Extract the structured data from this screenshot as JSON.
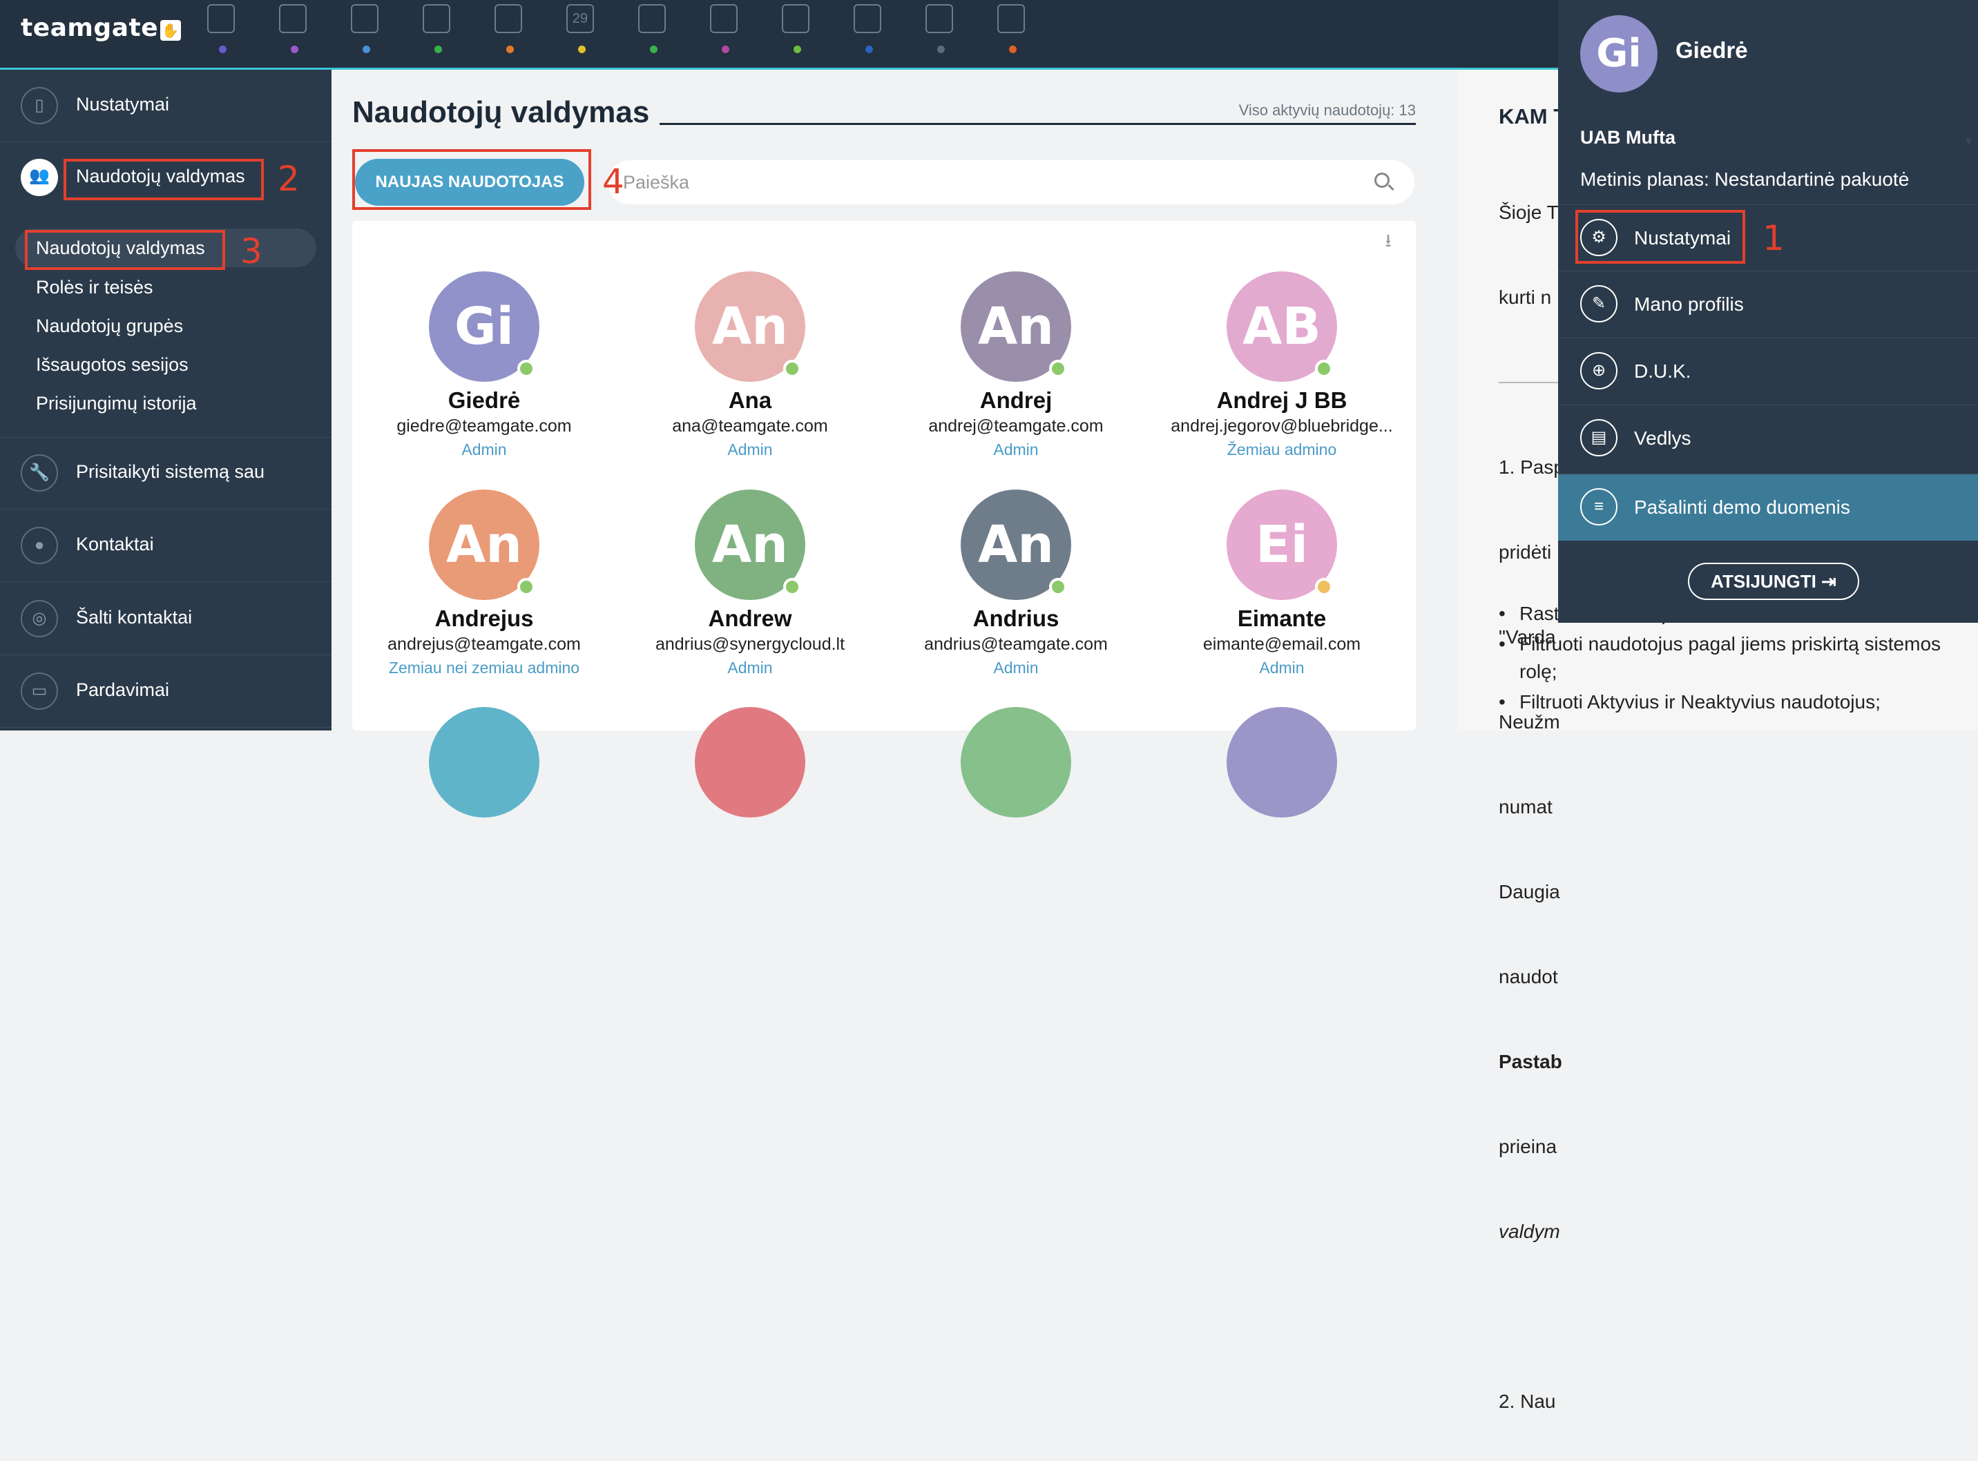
{
  "app": {
    "logo": "teamgate",
    "logo_mark": "✋"
  },
  "topnav": {
    "icons": [
      {
        "name": "dashboard-icon",
        "dot": "#6a5acd"
      },
      {
        "name": "target-icon",
        "dot": "#9b59d0"
      },
      {
        "name": "buildings-icon",
        "dot": "#4a90d9"
      },
      {
        "name": "contact-icon",
        "dot": "#38b24a"
      },
      {
        "name": "briefcase-icon",
        "dot": "#e07b2a"
      },
      {
        "name": "calendar-icon",
        "dot": "#e0c22a",
        "text": "29"
      },
      {
        "name": "chat-icon",
        "dot": "#38b24a"
      },
      {
        "name": "inbox-icon",
        "dot": "#b04aa0"
      },
      {
        "name": "attachment-icon",
        "dot": "#6bbf3a"
      },
      {
        "name": "pie-chart-icon",
        "dot": "#2a64c0"
      },
      {
        "name": "notes-icon",
        "dot": "#5a6a78"
      },
      {
        "name": "document-icon",
        "dot": "#e0602a"
      }
    ]
  },
  "sidebar": {
    "settings": "Nustatymai",
    "users": "Naudotojų valdymas",
    "sub": [
      "Naudotojų valdymas",
      "Rolės ir teisės",
      "Naudotojų grupės",
      "Išsaugotos sesijos",
      "Prisijungimų istorija"
    ],
    "customize": "Prisitaikyti sistemą sau",
    "contacts": "Kontaktai",
    "cold": "Šalti kontaktai",
    "sales": "Pardavimai"
  },
  "main": {
    "title": "Naudotojų valdymas",
    "total_users": "Viso aktyvių naudotojų: 13",
    "new_user_button": "NAUJAS NAUDOTOJAS",
    "search_placeholder": "Paieška",
    "users": [
      {
        "initials": "Gi",
        "name": "Giedrė",
        "email": "giedre@teamgate.com",
        "role": "Admin",
        "color": "#9192c9",
        "status": "#8cc96a"
      },
      {
        "initials": "An",
        "name": "Ana",
        "email": "ana@teamgate.com",
        "role": "Admin",
        "color": "#e8b2b0",
        "status": "#8cc96a"
      },
      {
        "initials": "An",
        "name": "Andrej",
        "email": "andrej@teamgate.com",
        "role": "Admin",
        "color": "#9a8faa",
        "status": "#8cc96a"
      },
      {
        "initials": "AB",
        "name": "Andrej J BB",
        "email": "andrej.jegorov@bluebridge...",
        "role": "Žemiau admino",
        "color": "#e3aad0",
        "status": "#8cc96a"
      },
      {
        "initials": "An",
        "name": "Andrejus",
        "email": "andrejus@teamgate.com",
        "role": "Zemiau nei zemiau admino",
        "color": "#e99a76",
        "status": "#8cc96a"
      },
      {
        "initials": "An",
        "name": "Andrew",
        "email": "andrius@synergycloud.lt",
        "role": "Admin",
        "color": "#7fb280",
        "status": "#8cc96a"
      },
      {
        "initials": "An",
        "name": "Andrius",
        "email": "andrius@teamgate.com",
        "role": "Admin",
        "color": "#6f7c8a",
        "status": "#8cc96a"
      },
      {
        "initials": "Ei",
        "name": "Eimante",
        "email": "eimante@email.com",
        "role": "Admin",
        "color": "#e6a9cf",
        "status": "#f0c060"
      }
    ],
    "row3_colors": [
      "#5fb4c9",
      "#e07a80",
      "#86c08a",
      "#9b95c8"
    ]
  },
  "help": {
    "title": "KAM T",
    "lines": [
      "Šioje T",
      "kurti n",
      "",
      "1. Pasp",
      "pridėti",
      "\"Varda",
      "Neužm",
      "numat",
      "Daugia",
      "naudot",
      "Pastab",
      "prieina",
      "valdym",
      "",
      "2. Nau"
    ],
    "bullets": [
      "Rast                   paieška;",
      "Filtruoti naudotojus pagal jiems priskirtą sistemos rolę;",
      "Filtruoti Aktyvius ir Neaktyvius naudotojus;"
    ]
  },
  "dropdown": {
    "initials": "Gi",
    "name": "Giedrė",
    "company": "UAB Mufta",
    "plan": "Metinis planas: Nestandartinė pakuotė",
    "items": [
      "Nustatymai",
      "Mano profilis",
      "D.U.K.",
      "Vedlys",
      "Pašalinti demo duomenis"
    ],
    "logout": "ATSIJUNGTI ⇥"
  },
  "annotations": [
    "1",
    "2",
    "3",
    "4"
  ]
}
